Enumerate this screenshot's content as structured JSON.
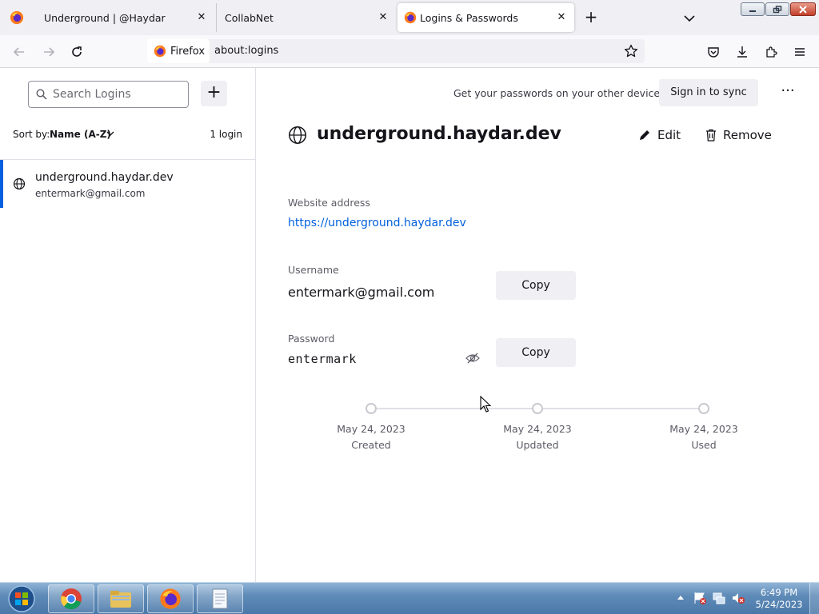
{
  "browser": {
    "tabs": [
      {
        "title": "Underground | @Haydar",
        "close": "✕"
      },
      {
        "title": "CollabNet",
        "close": "✕"
      },
      {
        "title": "Logins & Passwords",
        "close": "✕"
      }
    ],
    "new_tab_glyph": "+",
    "identity_label": "Firefox",
    "url": "about:logins",
    "accent_color": "#0060df"
  },
  "sidebar": {
    "search_placeholder": "Search Logins",
    "add_glyph": "+",
    "sort_label": "Sort by:",
    "sort_value": "Name (A-Z)",
    "count_label": "1 login",
    "logins": [
      {
        "origin": "underground.haydar.dev",
        "username": "entermark@gmail.com"
      }
    ]
  },
  "main": {
    "sync_text": "Get your passwords on your other devices",
    "sync_button": "Sign in to sync",
    "more_glyph": "···",
    "title": "underground.haydar.dev",
    "edit_label": "Edit",
    "remove_label": "Remove",
    "website_label": "Website address",
    "website_value": "https://underground.haydar.dev",
    "username_label": "Username",
    "username_value": "entermark@gmail.com",
    "password_label": "Password",
    "password_value": "entermark",
    "copy_label": "Copy",
    "timeline": [
      {
        "date": "May 24, 2023",
        "label": "Created"
      },
      {
        "date": "May 24, 2023",
        "label": "Updated"
      },
      {
        "date": "May 24, 2023",
        "label": "Used"
      }
    ]
  },
  "taskbar": {
    "time": "6:49 PM",
    "date": "5/24/2023"
  },
  "icons": {
    "firefox": "firefox-icon",
    "back": "back-arrow-icon",
    "forward": "forward-arrow-icon",
    "reload": "reload-icon",
    "bookmark": "star-icon",
    "pocket": "pocket-icon",
    "downloads": "download-icon",
    "extensions": "extensions-icon",
    "menu": "hamburger-menu-icon",
    "search": "search-icon",
    "globe": "globe-icon",
    "edit": "pencil-icon",
    "remove": "trash-icon",
    "reveal": "eye-slash-icon"
  }
}
